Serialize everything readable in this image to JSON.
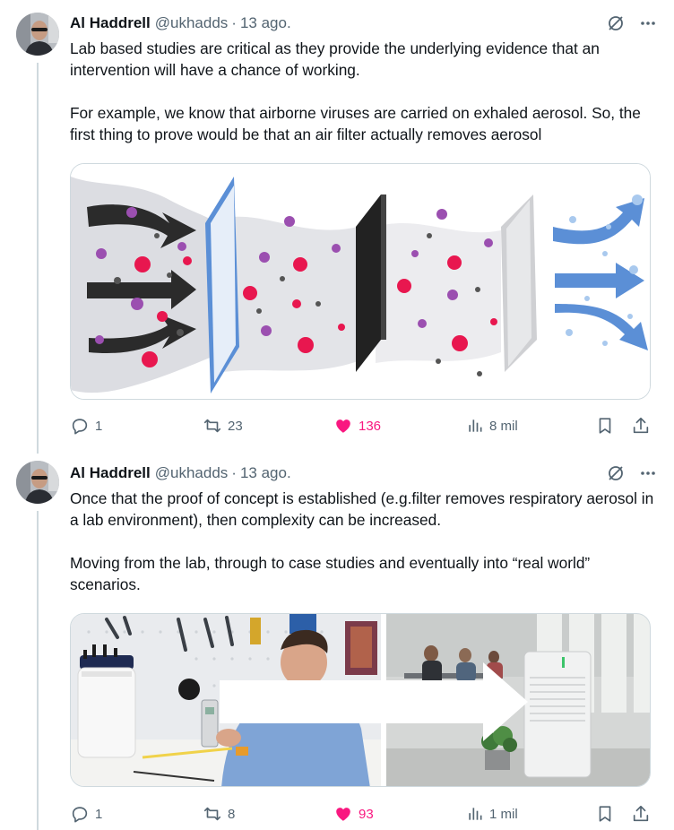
{
  "tweets": [
    {
      "author_name": "Al Haddrell",
      "handle": "@ukhadds",
      "separator": "·",
      "time": "13 ago.",
      "paragraphs": [
        "Lab based studies are critical as they provide the underlying evidence that an intervention will have a chance of working.",
        "For example, we know that airborne viruses are carried on exhaled aerosol. So, the first thing to prove would be that an air filter actually removes aerosol"
      ],
      "replies": "1",
      "reposts": "23",
      "likes": "136",
      "views": "8 mil"
    },
    {
      "author_name": "Al Haddrell",
      "handle": "@ukhadds",
      "separator": "·",
      "time": "13 ago.",
      "paragraphs": [
        "Once that the proof of concept is established (e.g.filter removes respiratory aerosol in a lab environment), then complexity can be increased.",
        "Moving from the lab, through to case studies and eventually into “real world” scenarios."
      ],
      "replies": "1",
      "reposts": "8",
      "likes": "93",
      "views": "1 mil"
    }
  ],
  "icons": {
    "grok": "grok-icon",
    "more": "more-icon",
    "reply": "reply-icon",
    "repost": "repost-icon",
    "like": "heart-icon",
    "views": "views-icon",
    "bookmark": "bookmark-icon",
    "share": "share-icon"
  },
  "colors": {
    "text": "#0f1419",
    "secondary": "#536471",
    "like": "#f91880",
    "border": "#cfd9de",
    "virus_pink": "#e8174f",
    "virus_purple": "#9b4fb0",
    "filter_blue": "#5b8fd6"
  }
}
